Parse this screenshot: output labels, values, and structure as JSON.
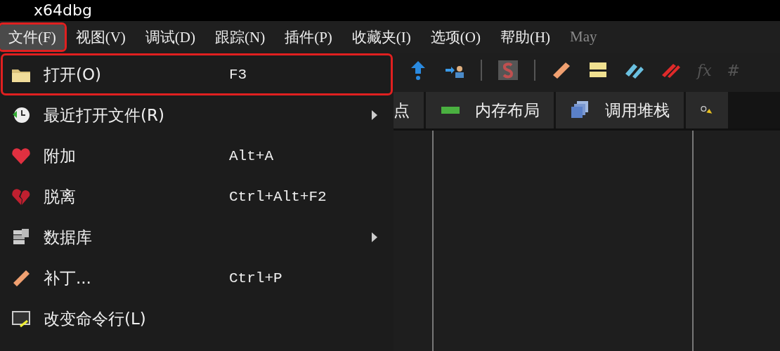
{
  "window": {
    "title": "x64dbg"
  },
  "menu_bar": [
    {
      "label": "文件(F)",
      "selected": true,
      "annotated": true
    },
    {
      "label": "视图(V)",
      "selected": false,
      "annotated": false
    },
    {
      "label": "调试(D)",
      "selected": false,
      "annotated": false
    },
    {
      "label": "跟踪(N)",
      "selected": false,
      "annotated": false
    },
    {
      "label": "插件(P)",
      "selected": false,
      "annotated": false
    },
    {
      "label": "收藏夹(I)",
      "selected": false,
      "annotated": false
    },
    {
      "label": "选项(O)",
      "selected": false,
      "annotated": false
    },
    {
      "label": "帮助(H)",
      "selected": false,
      "annotated": false
    },
    {
      "label": "May",
      "selected": false,
      "annotated": false,
      "disabled": true
    }
  ],
  "file_menu": [
    {
      "kind": "folder",
      "label": "打开(O)",
      "shortcut": "F3",
      "submenu": false,
      "annotated": true
    },
    {
      "kind": "clock",
      "label": "最近打开文件(R)",
      "submenu": true,
      "annotated": false
    },
    {
      "kind": "heart",
      "label": "附加",
      "shortcut": "Alt+A",
      "submenu": false,
      "annotated": false
    },
    {
      "kind": "broken-heart",
      "label": "脱离",
      "shortcut": "Ctrl+Alt+F2",
      "submenu": false,
      "annotated": false
    },
    {
      "kind": "database",
      "label": "数据库",
      "submenu": true,
      "annotated": false
    },
    {
      "kind": "bandage",
      "label": "补丁...",
      "shortcut": "Ctrl+P",
      "submenu": false,
      "annotated": false
    },
    {
      "kind": "terminal",
      "label": "改变命令行(L)",
      "submenu": false,
      "annotated": false
    }
  ],
  "toolbar": [
    {
      "kind": "up-arrow"
    },
    {
      "kind": "arrow-person"
    },
    {
      "kind": "sep"
    },
    {
      "kind": "s-block"
    },
    {
      "kind": "sep"
    },
    {
      "kind": "bandage"
    },
    {
      "kind": "notes"
    },
    {
      "kind": "tags"
    },
    {
      "kind": "stripes"
    },
    {
      "kind": "text",
      "label": "fx"
    },
    {
      "kind": "text",
      "label": "#"
    }
  ],
  "tabs": [
    {
      "kind": "none",
      "label": "点"
    },
    {
      "kind": "memory",
      "label": "内存布局"
    },
    {
      "kind": "stack",
      "label": "调用堆栈"
    },
    {
      "kind": "key"
    }
  ]
}
